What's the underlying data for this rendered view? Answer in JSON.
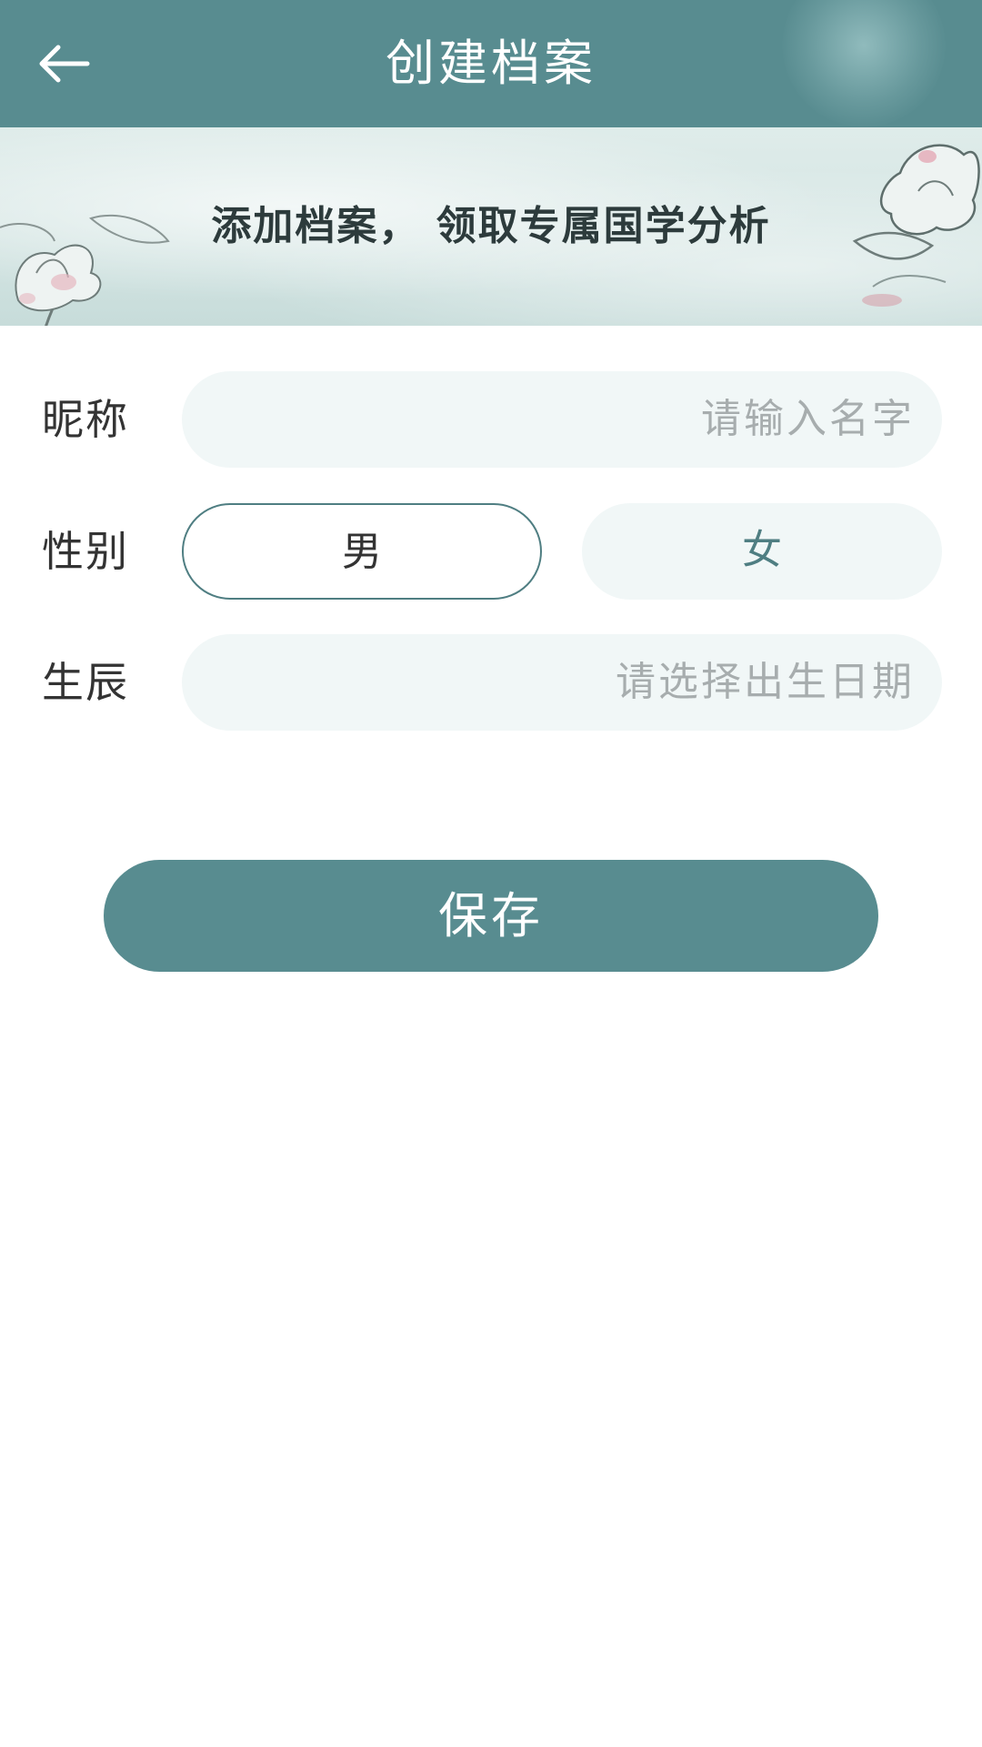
{
  "header": {
    "title": "创建档案",
    "back_icon": "arrow-left-icon"
  },
  "banner": {
    "text": "添加档案， 领取专属国学分析",
    "decoration": "lotus-painting"
  },
  "form": {
    "nickname": {
      "label": "昵称",
      "placeholder": "请输入名字",
      "value": ""
    },
    "gender": {
      "label": "性别",
      "options": [
        "男",
        "女"
      ],
      "selected": "男"
    },
    "birth": {
      "label": "生辰",
      "placeholder": "请选择出生日期",
      "value": ""
    }
  },
  "save_button": {
    "label": "保存"
  },
  "colors": {
    "primary": "#588c90",
    "input_bg": "#f1f7f7",
    "placeholder": "#a7adae",
    "text": "#333333"
  }
}
